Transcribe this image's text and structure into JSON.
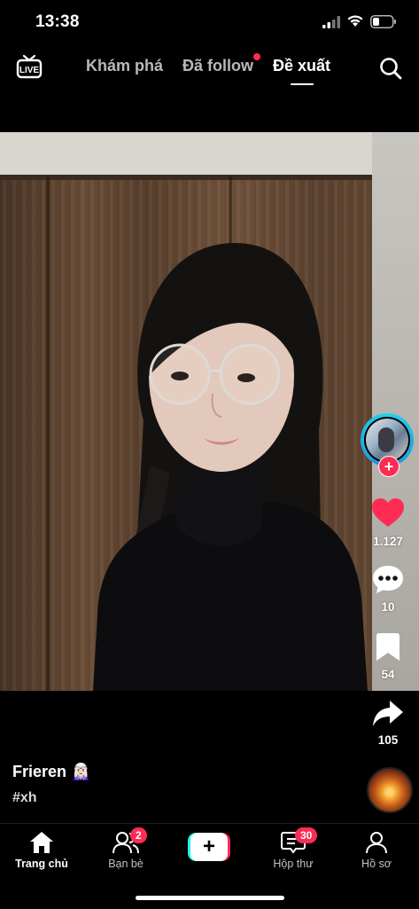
{
  "status_bar": {
    "time": "13:38"
  },
  "top_nav": {
    "live_label": "LIVE",
    "tabs": [
      {
        "label": "Khám phá",
        "active": false
      },
      {
        "label": "Đã follow",
        "active": false,
        "has_notification_dot": true
      },
      {
        "label": "Đề xuất",
        "active": true
      }
    ]
  },
  "actions": {
    "likes": "1.127",
    "comments": "10",
    "saves": "54",
    "shares": "105"
  },
  "caption": {
    "author": "Frieren",
    "author_emoji": "🧝🏻‍♀️",
    "hashtag": "#xh"
  },
  "bottom_nav": {
    "items": [
      {
        "label": "Trang chủ",
        "active": true
      },
      {
        "label": "Bạn bè",
        "badge": "2"
      },
      {
        "label": "create"
      },
      {
        "label": "Hộp thư",
        "badge": "30"
      },
      {
        "label": "Hồ sơ"
      }
    ]
  },
  "colors": {
    "accent": "#fe2c55",
    "cyan": "#25f4ee",
    "ring": "#20d5ec"
  }
}
